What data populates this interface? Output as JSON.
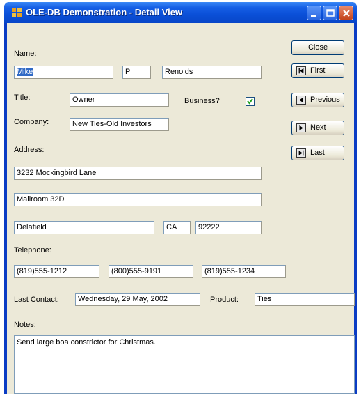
{
  "window": {
    "title": "OLE-DB Demonstration - Detail View"
  },
  "labels": {
    "name": "Name:",
    "title": "Title:",
    "business": "Business?",
    "company": "Company:",
    "address": "Address:",
    "telephone": "Telephone:",
    "last_contact": "Last Contact:",
    "product": "Product:",
    "notes": "Notes:"
  },
  "fields": {
    "first_name": "Mike",
    "middle_initial": "P",
    "last_name": "Renolds",
    "title": "Owner",
    "business_checked": true,
    "company": "New Ties-Old Investors",
    "address1": "3232 Mockingbird Lane",
    "address2": "Mailroom 32D",
    "city": "Delafield",
    "state": "CA",
    "zip": "92222",
    "phone1": "(819)555-1212",
    "phone2": "(800)555-9191",
    "phone3": "(819)555-1234",
    "last_contact": "Wednesday, 29 May, 2002",
    "product": "Ties",
    "notes": "Send large boa constrictor for Christmas."
  },
  "buttons": {
    "close": "Close",
    "first": "First",
    "previous": "Previous",
    "next": "Next",
    "last": "Last"
  }
}
